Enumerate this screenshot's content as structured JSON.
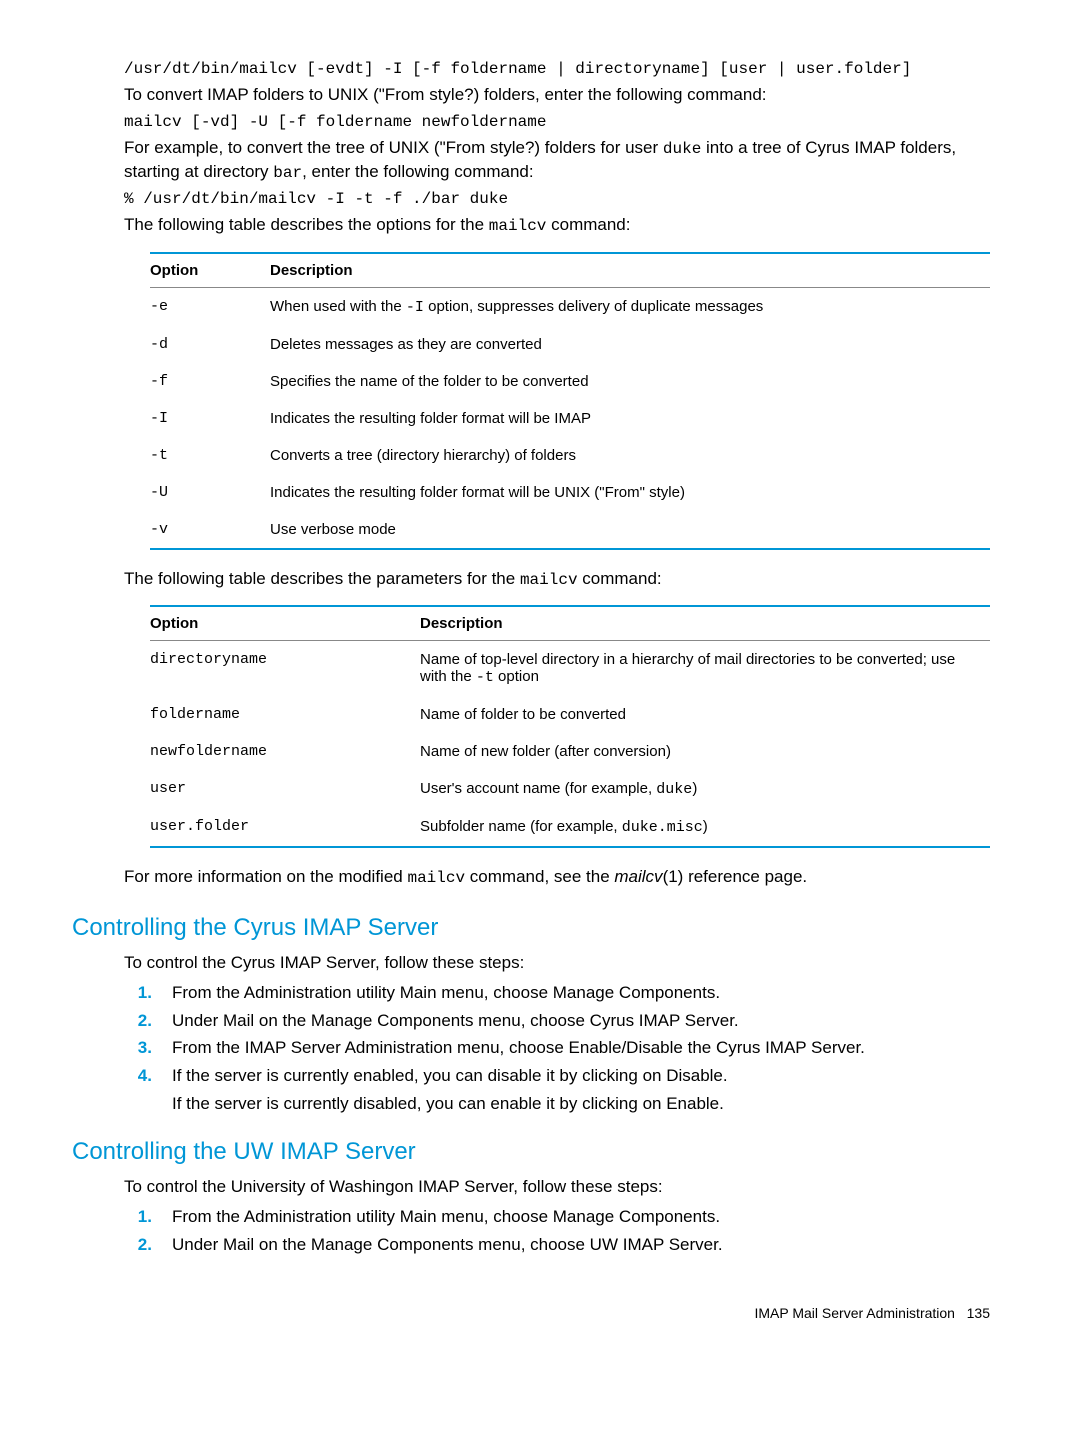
{
  "cmd1": "/usr/dt/bin/mailcv [-evdt] -I [-f foldername | directoryname] [user | user.folder]",
  "p1": "To convert IMAP folders to UNIX (\"From style?) folders, enter the following command:",
  "cmd2": "mailcv [-vd] -U [-f foldername newfoldername",
  "p2_pre": "For example, to convert the tree of UNIX (\"From style?) folders for user ",
  "p2_code1": "duke",
  "p2_mid": " into a tree of Cyrus IMAP folders, starting at directory ",
  "p2_code2": "bar",
  "p2_post": ", enter the following command:",
  "cmd3": "% /usr/dt/bin/mailcv -I -t -f ./bar duke",
  "p3_pre": "The following table describes the options for the ",
  "p3_code": "mailcv",
  "p3_post": " command:",
  "tbl1_header": {
    "col1": "Option",
    "col2": "Description"
  },
  "tbl1": [
    {
      "opt": "-e",
      "desc_pre": "When used with the ",
      "desc_code": "-I",
      "desc_post": " option, suppresses delivery of duplicate messages"
    },
    {
      "opt": "-d",
      "desc_pre": "Deletes messages as they are converted",
      "desc_code": "",
      "desc_post": ""
    },
    {
      "opt": "-f",
      "desc_pre": "Specifies the name of the folder to be converted",
      "desc_code": "",
      "desc_post": ""
    },
    {
      "opt": "-I",
      "desc_pre": "Indicates the resulting folder format will be IMAP",
      "desc_code": "",
      "desc_post": ""
    },
    {
      "opt": "-t",
      "desc_pre": "Converts a tree (directory hierarchy) of folders",
      "desc_code": "",
      "desc_post": ""
    },
    {
      "opt": "-U",
      "desc_pre": "Indicates the resulting folder format will be UNIX (\"From\" style)",
      "desc_code": "",
      "desc_post": ""
    },
    {
      "opt": "-v",
      "desc_pre": "Use verbose mode",
      "desc_code": "",
      "desc_post": ""
    }
  ],
  "p4_pre": "The following table describes the parameters for the ",
  "p4_code": "mailcv",
  "p4_post": " command:",
  "tbl2_header": {
    "col1": "Option",
    "col2": "Description"
  },
  "tbl2": [
    {
      "opt": "directoryname",
      "desc_pre": "Name of top-level directory in a hierarchy of mail directories to be converted; use with the ",
      "desc_code": "-t",
      "desc_post": " option"
    },
    {
      "opt": "foldername",
      "desc_pre": "Name of folder to be converted",
      "desc_code": "",
      "desc_post": ""
    },
    {
      "opt": "newfoldername",
      "desc_pre": "Name of new folder (after conversion)",
      "desc_code": "",
      "desc_post": ""
    },
    {
      "opt": "user",
      "desc_pre": "User's account name (for example, ",
      "desc_code": "duke",
      "desc_post": ")"
    },
    {
      "opt": "user.folder",
      "desc_pre": "Subfolder name (for example, ",
      "desc_code": "duke.misc",
      "desc_post": ")"
    }
  ],
  "p5_pre": "For more information on the modified ",
  "p5_code": "mailcv",
  "p5_mid": " command, see the ",
  "p5_em": "mailcv",
  "p5_post": "(1) reference page.",
  "h1": "Controlling the Cyrus IMAP Server",
  "h1_intro": "To control the Cyrus IMAP Server, follow these steps:",
  "h1_steps": [
    "From the Administration utility Main menu, choose Manage Components.",
    "Under Mail on the Manage Components menu, choose Cyrus IMAP Server.",
    "From the IMAP Server Administration menu, choose Enable/Disable the Cyrus IMAP Server.",
    "If the server is currently enabled, you can disable it by clicking on Disable."
  ],
  "h1_sub": "If the server is currently disabled, you can enable it by clicking on Enable.",
  "h2": "Controlling the UW IMAP Server",
  "h2_intro": "To control the University of Washingon IMAP Server, follow these steps:",
  "h2_steps": [
    "From the Administration utility Main menu, choose Manage Components.",
    "Under Mail on the Manage Components menu, choose UW IMAP Server."
  ],
  "footer_label": "IMAP Mail Server Administration",
  "footer_page": "135"
}
